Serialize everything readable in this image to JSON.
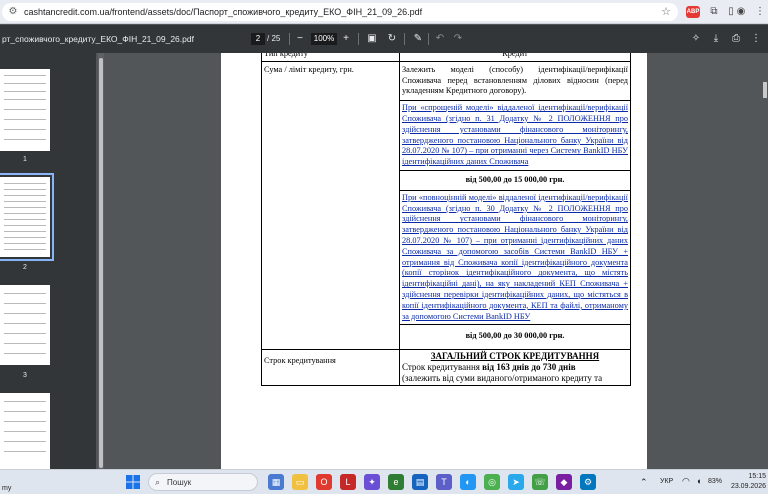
{
  "browser": {
    "url": "cashtancredit.com.ua/frontend/assets/doc/Паспорт_споживчого_кредиту_ЕКО_ФІН_21_09_26.pdf",
    "ext_badge": "ABP"
  },
  "pdf_toolbar": {
    "title": "рт_споживчого_кредиту_ЕКО_ФІН_21_09_26.pdf",
    "page_current": "2",
    "page_total": "/ 25",
    "zoom": "100%"
  },
  "thumbnails": [
    {
      "num": "1",
      "selected": false
    },
    {
      "num": "2",
      "selected": true
    },
    {
      "num": "3",
      "selected": false
    }
  ],
  "document": {
    "header_col1": "Тип кредиту",
    "header_col2": "Кредит",
    "row1_label": "Сума / ліміт кредиту, грн.",
    "row1_intro": "Залежить моделі (способу) ідентифікації/верифікації Споживача перед встановленням ділових відносин (перед укладенням Кредитного договору).",
    "row1_simple": "При «спрощеній моделі» віддаленої ідентифікації/верифікації Споживача (згідно п. 31 Додатку № 2 ПОЛОЖЕННЯ про здійснення установами фінансового моніторингу, затвердженого постановою Національного банку України від 28.07.2020 № 107) – при отриманні через Систему BankID НБУ ідентифікаційних даних Споживача",
    "row1_simple_amount": "від 500,00 до 15 000,00 грн.",
    "row1_full": "При «повноцінній моделі» віддаленої ідентифікації/верифікації Споживача (згідно п. 30 Додатку № 2 ПОЛОЖЕННЯ про здійснення установами фінансового моніторингу, затвердженого постановою Національного банку України від 28.07.2020 № 107) – при отриманні ідентифікаційних даних Споживача за допомогою засобів Системи BankID НБУ + отримання від Споживача копії ідентифікаційного документа (копії сторінок ідентифікаційного документа, що містять ідентифікаційні дані), на яку накладений КЕП Споживача + здійснення перевірки ідентифікаційних даних, що містяться в копії ідентифікаційного документа, КЕП та файлі, отриманому за допомогою Системи BankID НБУ",
    "row1_full_amount": "від 500,00 до 30 000,00 грн.",
    "row2_label": "Строк кредитування",
    "row2_heading": "ЗАГАЛЬНИЙ СТРОК КРЕДИТУВАННЯ",
    "row2_text_pre": "Строк кредитування ",
    "row2_text_bold": "від 163 днів до 730 днів",
    "row2_text_post": "(залежить від суми виданого/отриманого кредиту та"
  },
  "taskbar": {
    "search_placeholder": "Пошук",
    "lang": "УКР",
    "battery": "83%",
    "time": "15:15",
    "date": "23.09.2026",
    "left_text": "my"
  }
}
